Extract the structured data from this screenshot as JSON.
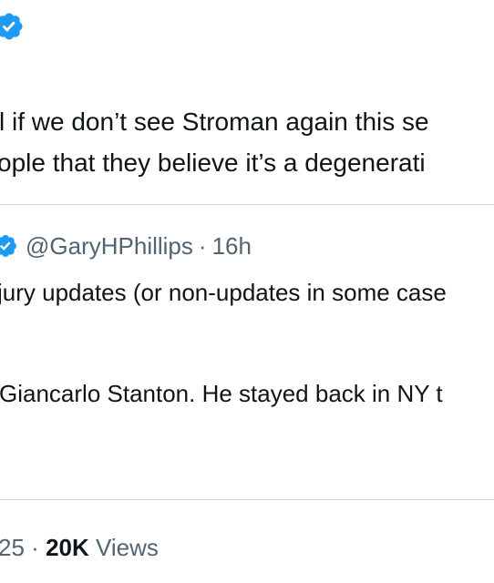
{
  "colors": {
    "verified_badge": "#1d9bf0",
    "text_primary": "#0f1419",
    "text_secondary": "#536471",
    "divider": "#cfd9de"
  },
  "icons": {
    "top_badge": "verified-badge-icon",
    "quote_badge": "verified-badge-icon"
  },
  "tweet": {
    "text_line_1": "l if we don’t see Stroman again this se",
    "text_line_2": "ople that they believe it’s a degenerati"
  },
  "quoted_tweet": {
    "handle": "@GaryHPhillips",
    "separator": "·",
    "time": "16h",
    "text_line_1": "jury updates (or non-updates in some case",
    "text_line_2": "Giancarlo Stanton. He stayed back in NY t"
  },
  "stats": {
    "time_fragment": "25",
    "separator": "·",
    "views_count": "20K",
    "views_label": "Views"
  }
}
